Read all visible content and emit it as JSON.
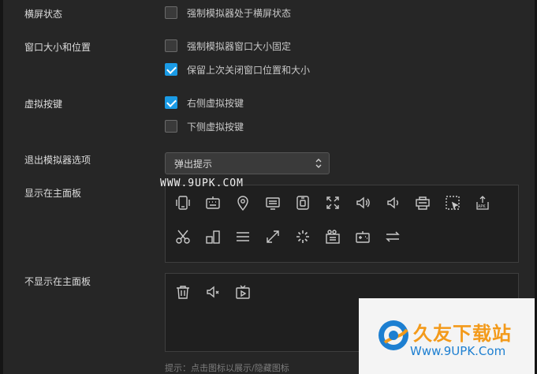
{
  "settings": {
    "landscape": {
      "label": "横屏状态",
      "option": "强制模拟器处于横屏状态",
      "checked": false
    },
    "window": {
      "label": "窗口大小和位置",
      "options": [
        {
          "text": "强制模拟器窗口大小固定",
          "checked": false
        },
        {
          "text": "保留上次关闭窗口位置和大小",
          "checked": true
        }
      ]
    },
    "virtual_keys": {
      "label": "虚拟按键",
      "options": [
        {
          "text": "右侧虚拟按键",
          "checked": true
        },
        {
          "text": "下侧虚拟按键",
          "checked": false
        }
      ]
    },
    "exit": {
      "label": "退出模拟器选项",
      "selected": "弹出提示"
    },
    "shown_panel": {
      "label": "显示在主面板",
      "icons": [
        "phone-shake-icon",
        "keyboard-icon",
        "location-icon",
        "screen-icon",
        "record-icon",
        "fullscreen-icon",
        "volume-up-icon",
        "volume-down-icon",
        "printer-icon",
        "mouse-cursor-icon",
        "apk-install-icon",
        "scissors-icon",
        "multi-window-icon",
        "menu-icon",
        "resize-icon",
        "loading-icon",
        "camera-icon",
        "gamepad-icon",
        "sync-icon"
      ]
    },
    "hidden_panel": {
      "label": "不显示在主面板",
      "icons": [
        "trash-icon",
        "mute-icon",
        "play-box-icon"
      ]
    },
    "hint": "提示：点击图标以展示/隐藏图标"
  },
  "watermark": {
    "top_text": "WWW.9UPK.COM",
    "brand_cn": "久友下载站",
    "brand_url": "Www.9UPK.Com"
  },
  "colors": {
    "accent": "#1a9be6",
    "brand_orange": "#f39a1a",
    "brand_blue": "#1d7fd1"
  }
}
